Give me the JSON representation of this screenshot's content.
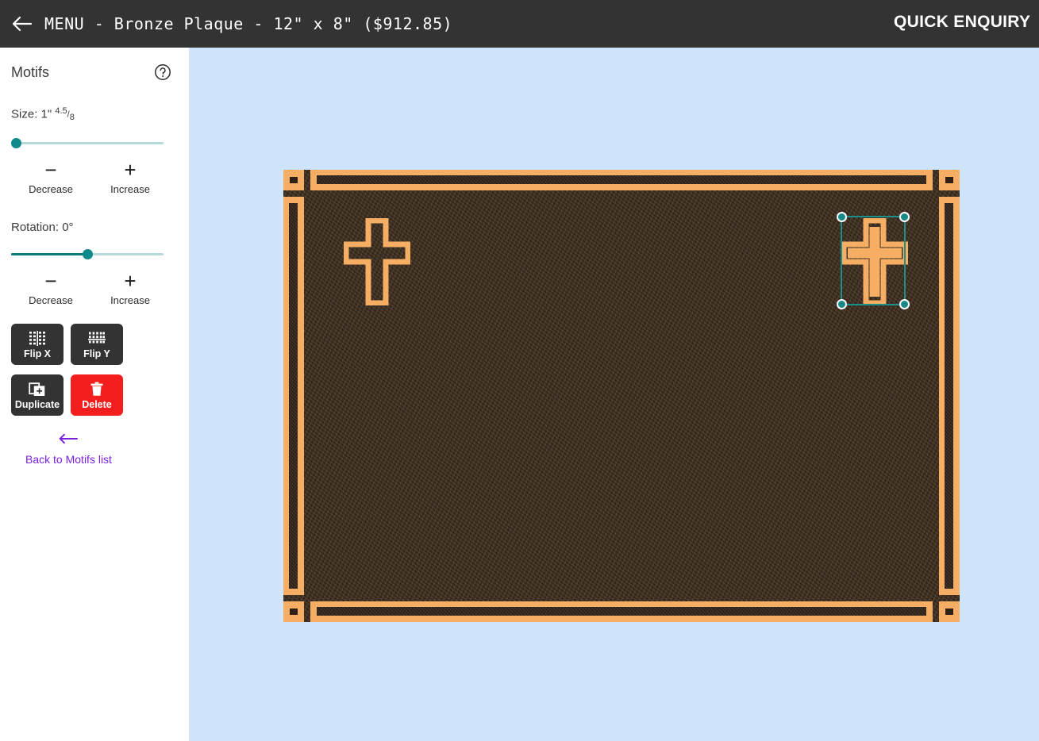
{
  "header": {
    "back_icon": "back-arrow-icon",
    "title": "MENU - Bronze Plaque - 12\" x 8\" ($912.85)",
    "quick_enquiry_label": "QUICK ENQUIRY"
  },
  "sidebar": {
    "panel_title": "Motifs",
    "help_icon": "question-circle-icon",
    "size": {
      "label_prefix": "Size: 1\"",
      "fraction_numerator": "4.5",
      "fraction_denominator": "8",
      "value_text": "Size: 1\" 4.5/8",
      "slider_percent": 0,
      "decrease_label": "Decrease",
      "increase_label": "Increase",
      "minus_glyph": "−",
      "plus_glyph": "+"
    },
    "rotation": {
      "label": "Rotation: 0°",
      "value_degrees": 0,
      "slider_percent": 50,
      "decrease_label": "Decrease",
      "increase_label": "Increase",
      "minus_glyph": "−",
      "plus_glyph": "+"
    },
    "actions": [
      {
        "label": "Flip X",
        "icon": "flip-horizontal-icon",
        "style": "dark"
      },
      {
        "label": "Flip Y",
        "icon": "flip-vertical-icon",
        "style": "dark"
      },
      {
        "label": "Duplicate",
        "icon": "duplicate-icon",
        "style": "dark"
      },
      {
        "label": "Delete",
        "icon": "trash-icon",
        "style": "danger"
      }
    ],
    "back_link": {
      "icon": "arrow-left-icon",
      "label": "Back to Motifs list"
    }
  },
  "canvas": {
    "background_color": "#cde4fa",
    "plaque": {
      "name": "Bronze Plaque",
      "size_label": "12\" x 8\"",
      "price_label": "$912.85",
      "border_color": "#f5ae63",
      "surface_color": "#3b2a1b",
      "motifs": [
        {
          "name": "cross-motif",
          "selected": false,
          "rotation_degrees": 0
        },
        {
          "name": "cross-motif",
          "selected": true,
          "rotation_degrees": 0
        }
      ]
    },
    "selection": {
      "accent_color": "#178a88",
      "handle_count": 4
    }
  }
}
